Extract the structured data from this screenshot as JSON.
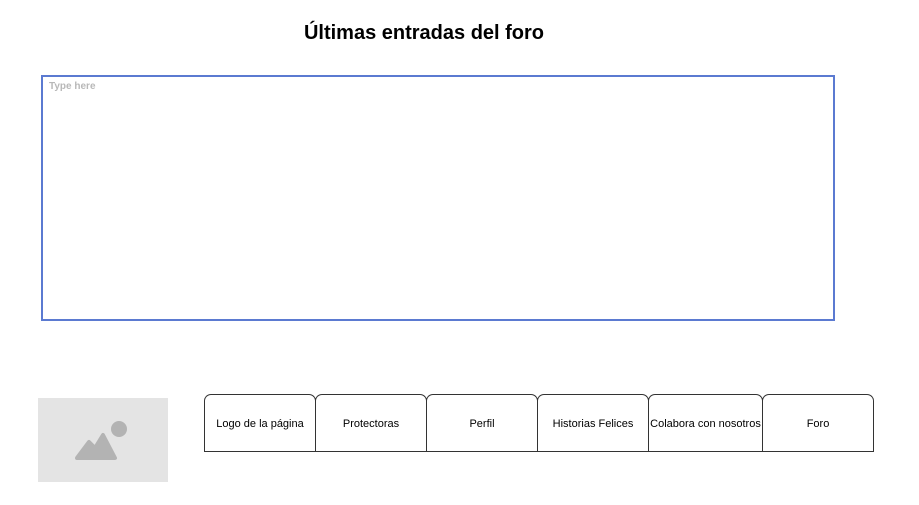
{
  "header": {
    "title": "Últimas entradas del foro"
  },
  "forum_input": {
    "placeholder": "Type here",
    "value": ""
  },
  "image": {
    "icon": "image-icon"
  },
  "nav": {
    "tabs": [
      {
        "label": "Logo de la página"
      },
      {
        "label": "Protectoras"
      },
      {
        "label": "Perfil"
      },
      {
        "label": "Historias Felices"
      },
      {
        "label": "Colabora con nosotros"
      },
      {
        "label": "Foro"
      }
    ]
  },
  "colors": {
    "textarea_border": "#5b7ad1",
    "placeholder_bg": "#e4e4e4",
    "icon": "#b3b3b3"
  }
}
